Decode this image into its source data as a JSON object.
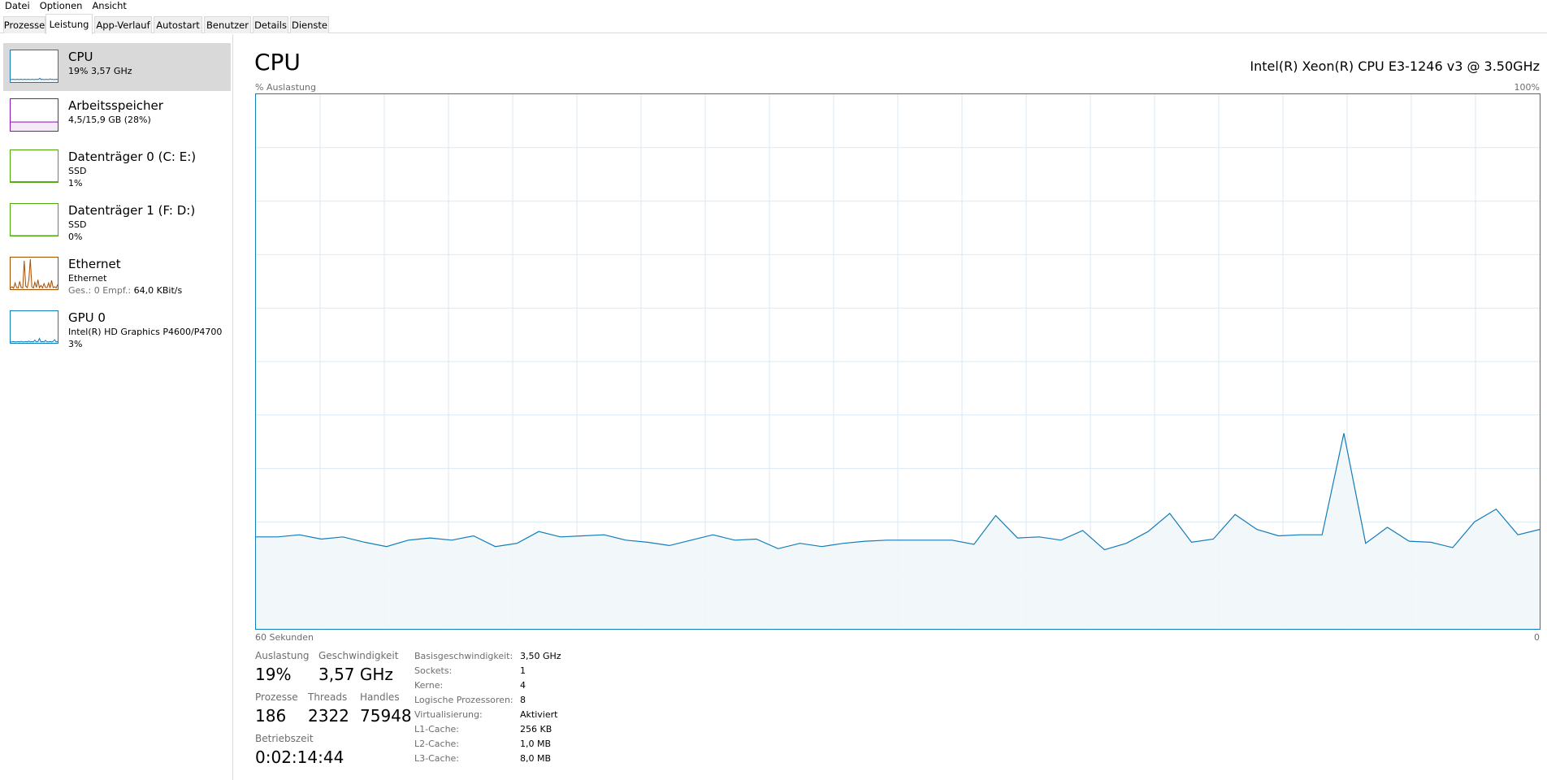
{
  "menu": [
    "Datei",
    "Optionen",
    "Ansicht"
  ],
  "tabs": [
    "Prozesse",
    "Leistung",
    "App-Verlauf",
    "Autostart",
    "Benutzer",
    "Details",
    "Dienste"
  ],
  "active_tab": "Leistung",
  "sidebar": {
    "items": [
      {
        "title": "CPU",
        "line1": "19% 3,57 GHz",
        "line2": "",
        "color": "#117dbb",
        "fill": "#f1f6fa",
        "selected": true
      },
      {
        "title": "Arbeitsspeicher",
        "line1": "4,5/15,9 GB (28%)",
        "line2": "",
        "color": "#8b12ae",
        "fill": "#f4eaf7",
        "selected": false
      },
      {
        "title": "Datenträger 0 (C: E:)",
        "line1": "SSD",
        "line2": "1%",
        "color": "#4da60c",
        "fill": "#eff7e7",
        "selected": false
      },
      {
        "title": "Datenträger 1 (F: D:)",
        "line1": "SSD",
        "line2": "0%",
        "color": "#4da60c",
        "fill": "#eff7e7",
        "selected": false
      },
      {
        "title": "Ethernet",
        "line1": "Ethernet",
        "line2_label": "Ges.: 0 Empf.:",
        "line2": "64,0 KBit/s",
        "color": "#a74f01",
        "fill": "#fcf3eb",
        "selected": false
      },
      {
        "title": "GPU 0",
        "line1": "Intel(R) HD Graphics P4600/P4700",
        "line2": "3%",
        "color": "#117dbb",
        "fill": "#f1f6fa",
        "selected": false
      }
    ]
  },
  "main": {
    "title": "CPU",
    "cpu_model": "Intel(R) Xeon(R) CPU E3-1246 v3 @ 3.50GHz",
    "y_label": "% Auslastung",
    "y_max_label": "100%",
    "x_left_label": "60 Sekunden",
    "x_right_label": "0",
    "stats": {
      "auslastung_label": "Auslastung",
      "auslastung": "19%",
      "geschwindigkeit_label": "Geschwindigkeit",
      "geschwindigkeit": "3,57 GHz",
      "prozesse_label": "Prozesse",
      "prozesse": "186",
      "threads_label": "Threads",
      "threads": "2322",
      "handles_label": "Handles",
      "handles": "75948",
      "betriebszeit_label": "Betriebszeit",
      "betriebszeit": "0:02:14:44"
    },
    "specs": [
      {
        "label": "Basisgeschwindigkeit:",
        "value": "3,50 GHz"
      },
      {
        "label": "Sockets:",
        "value": "1"
      },
      {
        "label": "Kerne:",
        "value": "4"
      },
      {
        "label": "Logische Prozessoren:",
        "value": "8"
      },
      {
        "label": "Virtualisierung:",
        "value": "Aktiviert"
      },
      {
        "label": "L1-Cache:",
        "value": "256 KB"
      },
      {
        "label": "L2-Cache:",
        "value": "1,0 MB"
      },
      {
        "label": "L3-Cache:",
        "value": "8,0 MB"
      }
    ]
  },
  "chart_data": {
    "type": "area",
    "xlabel": "60 Sekunden",
    "ylabel": "% Auslastung",
    "ylim": [
      0,
      100
    ],
    "xlim": [
      60,
      0
    ],
    "grid": true,
    "line_color": "#117dbb",
    "fill_color": "#f1f6fa",
    "grid_color": "#d9eaf4",
    "series": [
      {
        "values": [
          17.2,
          17.2,
          17.6,
          16.8,
          17.2,
          16.2,
          15.4,
          16.6,
          17.0,
          16.6,
          17.4,
          15.4,
          16.0,
          18.2,
          17.2,
          17.4,
          17.6,
          16.6,
          16.2,
          15.6,
          16.6,
          17.6,
          16.6,
          16.8,
          15.0,
          16.0,
          15.4,
          16.0,
          16.4,
          16.6,
          16.6,
          16.6,
          16.6,
          15.8,
          21.2,
          17.0,
          17.2,
          16.6,
          18.4,
          14.8,
          16.0,
          18.2,
          21.6,
          16.2,
          16.8,
          21.4,
          18.6,
          17.4,
          17.6,
          17.6,
          36.6,
          16.0,
          19.0,
          16.4,
          16.2,
          15.2,
          20.0,
          22.4,
          17.6,
          18.6
        ]
      }
    ]
  }
}
